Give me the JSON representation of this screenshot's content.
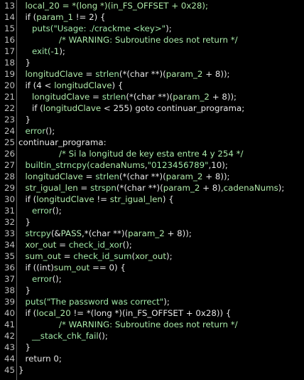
{
  "editor": {
    "lines": [
      {
        "n": "13",
        "indent": 1,
        "tokens": [
          [
            "local_20 = *(long *)(in_FS_OFFSET + 0x28);",
            "var"
          ]
        ]
      },
      {
        "n": "14",
        "indent": 1,
        "tokens": [
          [
            "if (",
            "plain"
          ],
          [
            "param_1",
            "var"
          ],
          [
            " != 2) {",
            "plain"
          ]
        ]
      },
      {
        "n": "15",
        "indent": 2,
        "tokens": [
          [
            "puts(",
            "fn"
          ],
          [
            "\"Usage: ./crackme <key>\"",
            "str"
          ],
          [
            ");",
            "plain"
          ]
        ]
      },
      {
        "n": "16",
        "indent": 6,
        "tokens": [
          [
            "/* WARNING: Subroutine does not return */",
            "cm"
          ]
        ]
      },
      {
        "n": "17",
        "indent": 2,
        "tokens": [
          [
            "exit(",
            "fn"
          ],
          [
            "-1",
            "const"
          ],
          [
            ");",
            "plain"
          ]
        ]
      },
      {
        "n": "18",
        "indent": 1,
        "tokens": [
          [
            "}",
            "plain"
          ]
        ]
      },
      {
        "n": "19",
        "indent": 1,
        "tokens": [
          [
            "longitudClave",
            "var"
          ],
          [
            " = ",
            "plain"
          ],
          [
            "strlen",
            "fn"
          ],
          [
            "(*(char **)(",
            "plain"
          ],
          [
            "param_2",
            "var"
          ],
          [
            " + 8));",
            "plain"
          ]
        ]
      },
      {
        "n": "20",
        "indent": 1,
        "tokens": [
          [
            "if (4 < ",
            "plain"
          ],
          [
            "longitudClave",
            "var"
          ],
          [
            ") {",
            "plain"
          ]
        ]
      },
      {
        "n": "21",
        "indent": 2,
        "tokens": [
          [
            "longitudClave",
            "var"
          ],
          [
            " = ",
            "plain"
          ],
          [
            "strlen",
            "fn"
          ],
          [
            "(*(char **)(",
            "plain"
          ],
          [
            "param_2",
            "var"
          ],
          [
            " + 8));",
            "plain"
          ]
        ]
      },
      {
        "n": "22",
        "indent": 2,
        "tokens": [
          [
            "if (",
            "plain"
          ],
          [
            "longitudClave",
            "var"
          ],
          [
            " < 255) goto continuar_programa;",
            "plain"
          ]
        ]
      },
      {
        "n": "23",
        "indent": 1,
        "tokens": [
          [
            "}",
            "plain"
          ]
        ]
      },
      {
        "n": "24",
        "indent": 1,
        "tokens": [
          [
            "error",
            "fn"
          ],
          [
            "();",
            "plain"
          ]
        ]
      },
      {
        "n": "25",
        "indent": 0,
        "label": true,
        "tokens": [
          [
            "continuar_programa:",
            "plain"
          ]
        ]
      },
      {
        "n": "26",
        "indent": 6,
        "tokens": [
          [
            "/* Si la longitud de key esta entre 4 y 254 */",
            "cm"
          ]
        ]
      },
      {
        "n": "27",
        "indent": 1,
        "tokens": [
          [
            "builtin_strncpy(",
            "fn"
          ],
          [
            "cadenaNums",
            "var"
          ],
          [
            ",",
            "plain"
          ],
          [
            "\"0123456789\"",
            "str"
          ],
          [
            ",10);",
            "plain"
          ]
        ]
      },
      {
        "n": "28",
        "indent": 1,
        "tokens": [
          [
            "longitudClave",
            "var"
          ],
          [
            " = ",
            "plain"
          ],
          [
            "strlen",
            "fn"
          ],
          [
            "(*(char **)(",
            "plain"
          ],
          [
            "param_2",
            "var"
          ],
          [
            " + 8));",
            "plain"
          ]
        ]
      },
      {
        "n": "29",
        "indent": 1,
        "tokens": [
          [
            "str_igual_len",
            "var"
          ],
          [
            " = ",
            "plain"
          ],
          [
            "strspn",
            "fn"
          ],
          [
            "(*(char **)(",
            "plain"
          ],
          [
            "param_2",
            "var"
          ],
          [
            " + 8),",
            "plain"
          ],
          [
            "cadenaNums",
            "var"
          ],
          [
            ");",
            "plain"
          ]
        ]
      },
      {
        "n": "30",
        "indent": 1,
        "tokens": [
          [
            "if (",
            "plain"
          ],
          [
            "longitudClave",
            "var"
          ],
          [
            " != ",
            "plain"
          ],
          [
            "str_igual_len",
            "var"
          ],
          [
            ") {",
            "plain"
          ]
        ]
      },
      {
        "n": "31",
        "indent": 2,
        "tokens": [
          [
            "error",
            "fn"
          ],
          [
            "();",
            "plain"
          ]
        ]
      },
      {
        "n": "32",
        "indent": 1,
        "tokens": [
          [
            "}",
            "plain"
          ]
        ]
      },
      {
        "n": "33",
        "indent": 1,
        "tokens": [
          [
            "strcpy",
            "fn"
          ],
          [
            "(&",
            "plain"
          ],
          [
            "PASS",
            "const"
          ],
          [
            ",*(char **)(",
            "plain"
          ],
          [
            "param_2",
            "var"
          ],
          [
            " + 8));",
            "plain"
          ]
        ]
      },
      {
        "n": "34",
        "indent": 1,
        "tokens": [
          [
            "xor_out",
            "var"
          ],
          [
            " = ",
            "plain"
          ],
          [
            "check_id_xor",
            "fn"
          ],
          [
            "();",
            "plain"
          ]
        ]
      },
      {
        "n": "35",
        "indent": 1,
        "tokens": [
          [
            "sum_out",
            "var"
          ],
          [
            " = ",
            "plain"
          ],
          [
            "check_id_sum",
            "fn"
          ],
          [
            "(",
            "plain"
          ],
          [
            "xor_out",
            "var"
          ],
          [
            ");",
            "plain"
          ]
        ]
      },
      {
        "n": "36",
        "indent": 1,
        "tokens": [
          [
            "if ((int)",
            "plain"
          ],
          [
            "sum_out",
            "var"
          ],
          [
            " == 0) {",
            "plain"
          ]
        ]
      },
      {
        "n": "37",
        "indent": 2,
        "tokens": [
          [
            "error",
            "fn"
          ],
          [
            "();",
            "plain"
          ]
        ]
      },
      {
        "n": "38",
        "indent": 1,
        "tokens": [
          [
            "}",
            "plain"
          ]
        ]
      },
      {
        "n": "39",
        "indent": 1,
        "tokens": [
          [
            "puts(",
            "fn"
          ],
          [
            "\"The password was correct\"",
            "str"
          ],
          [
            ");",
            "plain"
          ]
        ]
      },
      {
        "n": "40",
        "indent": 1,
        "tokens": [
          [
            "if (",
            "plain"
          ],
          [
            "local_20",
            "var"
          ],
          [
            " != *(long *)(in_FS_OFFSET + 0x28)) {",
            "plain"
          ]
        ]
      },
      {
        "n": "41",
        "indent": 6,
        "tokens": [
          [
            "/* WARNING: Subroutine does not return */",
            "cm"
          ]
        ]
      },
      {
        "n": "42",
        "indent": 2,
        "tokens": [
          [
            "__stack_chk_fail",
            "fn"
          ],
          [
            "();",
            "plain"
          ]
        ]
      },
      {
        "n": "43",
        "indent": 1,
        "tokens": [
          [
            "}",
            "plain"
          ]
        ]
      },
      {
        "n": "44",
        "indent": 1,
        "tokens": [
          [
            "return 0;",
            "plain"
          ]
        ]
      },
      {
        "n": "45",
        "indent": 0,
        "brace": true,
        "tokens": [
          [
            "}",
            "plain"
          ]
        ]
      }
    ]
  }
}
